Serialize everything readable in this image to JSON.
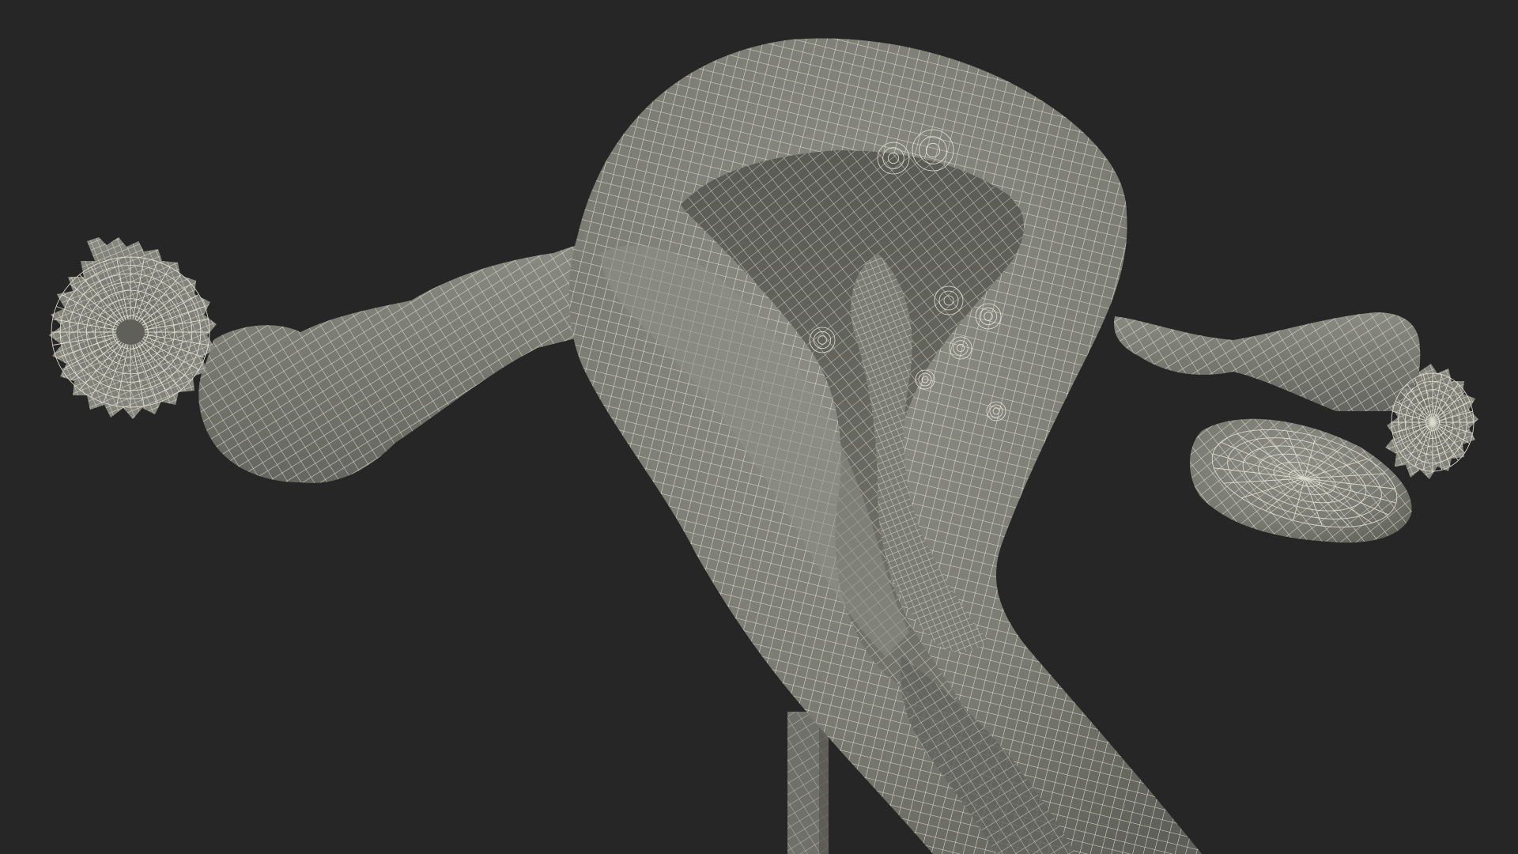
{
  "scene": {
    "subject": "uterus-wireframe-model",
    "colors": {
      "background": "#262626",
      "surface": "#7c7d74",
      "surface_light": "#8c8d84",
      "surface_shadow": "#5b5c55",
      "wire": "#e6e4d6"
    }
  }
}
